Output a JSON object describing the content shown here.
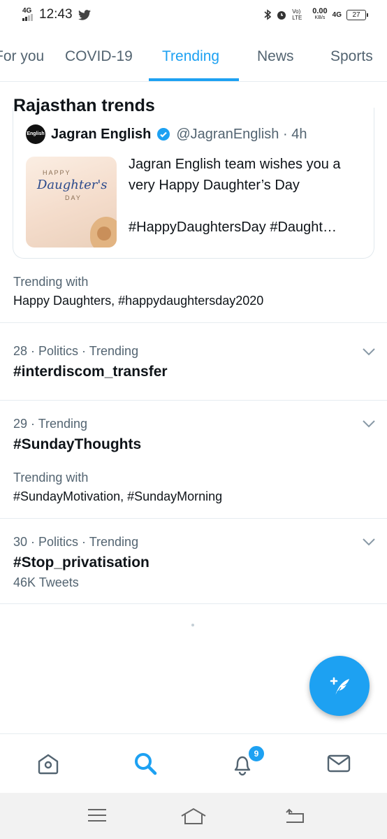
{
  "status_bar": {
    "network": "4G",
    "time": "12:43",
    "data_speed": "0.00",
    "data_speed_unit": "KB/s",
    "volte": "Vo) LTE",
    "network2": "4G",
    "battery": "27"
  },
  "tabs": [
    {
      "label": "For you"
    },
    {
      "label": "COVID-19"
    },
    {
      "label": "Trending",
      "active": true
    },
    {
      "label": "News"
    },
    {
      "label": "Sports"
    }
  ],
  "section_title": "Rajasthan trends",
  "tweet_card": {
    "avatar_text": "English",
    "author": "Jagran English",
    "handle": "@JagranEnglish · 4h",
    "text": "Jagran English team wishes you a very Happy Daughter’s Day",
    "hashtags": "#HappyDaughtersDay #Daught…",
    "image": {
      "line1": "HAPPY",
      "line2": "Daughter's",
      "line3": "DAY"
    }
  },
  "trending_with_1": {
    "label": "Trending with",
    "value": "Happy Daughters, #happydaughtersday2020"
  },
  "trends": [
    {
      "meta": "28 · Politics · Trending",
      "title": "#interdiscom_transfer"
    },
    {
      "meta": "29 · Trending",
      "title": "#SundayThoughts",
      "sub_label": "Trending with",
      "sub_value": "#SundayMotivation, #SundayMorning"
    },
    {
      "meta": "30 · Politics · Trending",
      "title": "#Stop_privatisation",
      "count": "46K Tweets"
    }
  ],
  "bottom_nav": {
    "items": [
      "home-icon",
      "search-icon",
      "notifications-icon",
      "messages-icon"
    ],
    "notifications_badge": "9"
  },
  "colors": {
    "accent": "#1da1f2",
    "text": "#0f1419",
    "secondary": "#536471"
  }
}
